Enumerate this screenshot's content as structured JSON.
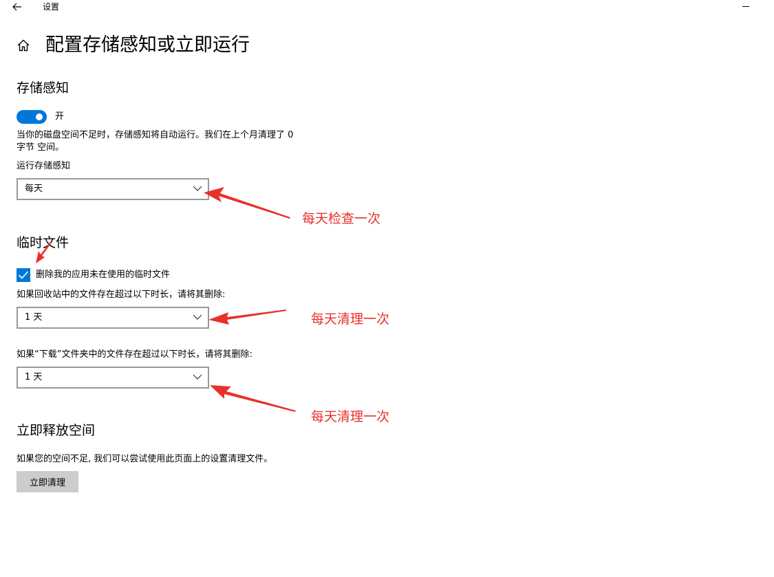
{
  "window": {
    "title": "设置",
    "back_icon": "back-arrow-icon",
    "minimize_icon": "minimize-icon"
  },
  "header": {
    "home_icon": "home-icon",
    "title": "配置存储感知或立即运行"
  },
  "storage_sense": {
    "heading": "存储感知",
    "toggle_state": "开",
    "toggle_on": true,
    "description_line1": "当你的磁盘空间不足时，存储感知将自动运行。我们在上个月清理了 0",
    "description_line2": "字节 空间。",
    "run_label": "运行存储感知",
    "run_value": "每天"
  },
  "temp_files": {
    "heading": "临时文件",
    "delete_checkbox_label": "删除我的应用未在使用的临时文件",
    "delete_checked": true,
    "recycle_label": "如果回收站中的文件存在超过以下时长，请将其删除:",
    "recycle_value": "1 天",
    "downloads_label": "如果“下载”文件夹中的文件存在超过以下时长，请将其删除:",
    "downloads_value": "1 天"
  },
  "free_space": {
    "heading": "立即释放空间",
    "description": "如果您的空间不足, 我们可以尝试使用此页面上的设置清理文件。",
    "button_label": "立即清理"
  },
  "annotations": {
    "color": "#e8312b",
    "run_note": "每天检查一次",
    "recycle_note": "每天清理一次",
    "downloads_note": "每天清理一次"
  },
  "colors": {
    "accent": "#0078d7",
    "button_bg": "#cccccc",
    "dropdown_border": "#999999"
  }
}
